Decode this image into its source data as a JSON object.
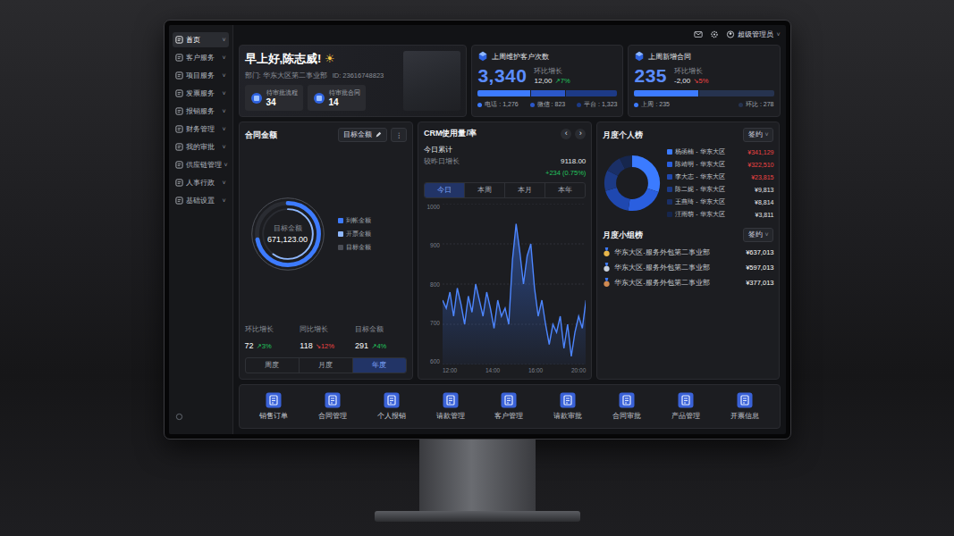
{
  "caret": "˅",
  "topbar": {
    "user": "超级管理员"
  },
  "sidebar": {
    "items": [
      {
        "label": "首页",
        "selected": true
      },
      {
        "label": "客户服务",
        "selected": false
      },
      {
        "label": "项目服务",
        "selected": false
      },
      {
        "label": "发票服务",
        "selected": false
      },
      {
        "label": "报销服务",
        "selected": false
      },
      {
        "label": "财务管理",
        "selected": false
      },
      {
        "label": "我的审批",
        "selected": false
      },
      {
        "label": "供应链管理",
        "selected": false
      },
      {
        "label": "人事行政",
        "selected": false
      },
      {
        "label": "基础设置",
        "selected": false
      }
    ]
  },
  "welcome": {
    "greeting": "早上好,陈志威!",
    "icon": "☀",
    "department": "部门: 华东大区第二事业部",
    "id": "ID: 23616748823",
    "stats": [
      {
        "label": "待审批流程",
        "value": "34"
      },
      {
        "label": "待审批合同",
        "value": "14"
      }
    ]
  },
  "kpis": [
    {
      "title": "上周维护客户次数",
      "value": "3,340",
      "compare_label": "环比增长",
      "compare_value": "12,00",
      "change": "↗7%",
      "trend": "up",
      "segments": [
        {
          "label": "电话 : 1,276",
          "level": 0.38,
          "color": "#3d7bff"
        },
        {
          "label": "微信 : 823",
          "level": 0.25,
          "color": "#2b57c9"
        },
        {
          "label": "平台 : 1,323",
          "level": 0.37,
          "color": "#1d3a86"
        }
      ]
    },
    {
      "title": "上周新增合同",
      "value": "235",
      "compare_label": "环比增长",
      "compare_value": "-2,00",
      "change": "↘5%",
      "trend": "down",
      "segments": [
        {
          "label": "上周 : 235",
          "level": 0.46,
          "color": "#3d7bff"
        },
        {
          "label": "环比 : 278",
          "level": 0.54,
          "color": "#26334f"
        }
      ]
    }
  ],
  "contract": {
    "title": "合同金额",
    "button": "目标金额",
    "menu": "⋮",
    "center_label": "目标金额",
    "center_value": "671,123.00",
    "rings": [
      {
        "label": "到帐金额",
        "level": 0.72,
        "color": "#3d7bff"
      },
      {
        "label": "开票金额",
        "level": 0.6,
        "color": "#8fb8ff"
      },
      {
        "label": "目标金额",
        "level": 1.0,
        "color": "#4a4d55"
      }
    ],
    "stats": [
      {
        "label": "环比增长",
        "value": "72",
        "change": "↗3%",
        "trend": "up"
      },
      {
        "label": "同比增长",
        "value": "118",
        "change": "↘12%",
        "trend": "down"
      },
      {
        "label": "目标金额",
        "value": "291",
        "change": "↗4%",
        "trend": "up"
      }
    ],
    "tabs": [
      {
        "label": "周度",
        "selected": false
      },
      {
        "label": "月度",
        "selected": false
      },
      {
        "label": "年度",
        "selected": true
      }
    ]
  },
  "crm": {
    "title": "CRM使用量/率",
    "prev": "‹",
    "next": "›",
    "total_label": "今日累计",
    "growth_label": "较昨日增长",
    "total_value": "9118.00",
    "growth_value": "+234 (0.75%)",
    "tabs": [
      {
        "label": "今日",
        "selected": true
      },
      {
        "label": "本周",
        "selected": false
      },
      {
        "label": "本月",
        "selected": false
      },
      {
        "label": "本年",
        "selected": false
      }
    ],
    "chart": {
      "y_ticks": [
        "1000",
        "900",
        "800",
        "700",
        "600"
      ],
      "x_ticks": [
        "12:00",
        "14:00",
        "16:00",
        "20:00"
      ],
      "values": [
        760,
        740,
        780,
        720,
        790,
        750,
        700,
        770,
        730,
        800,
        760,
        720,
        780,
        740,
        690,
        760,
        720,
        740,
        700,
        860,
        950,
        880,
        800,
        870,
        900,
        790,
        720,
        760,
        700,
        650,
        700,
        680,
        720,
        640,
        700,
        620,
        680,
        720,
        690,
        760
      ]
    }
  },
  "ranking": {
    "title": "月度个人榜",
    "filter": "签约",
    "people": [
      {
        "name": "杨函楠 - 华东大区",
        "amount": "¥341,129",
        "highlight": true,
        "level": 0.3,
        "color": "#3b7bff"
      },
      {
        "name": "陈靖明 - 华东大区",
        "amount": "¥322,510",
        "highlight": true,
        "level": 0.22,
        "color": "#2a5fe0"
      },
      {
        "name": "李大志 - 华东大区",
        "amount": "¥23,815",
        "highlight": true,
        "level": 0.18,
        "color": "#1f48b0"
      },
      {
        "name": "陈二妮 - 华东大区",
        "amount": "¥9,813",
        "highlight": false,
        "level": 0.12,
        "color": "#1c3a86"
      },
      {
        "name": "王燕琦 - 华东大区",
        "amount": "¥8,814",
        "highlight": false,
        "level": 0.1,
        "color": "#1a2f66"
      },
      {
        "name": "汪雨萌 - 华东大区",
        "amount": "¥3,811",
        "highlight": false,
        "level": 0.08,
        "color": "#16264d"
      }
    ]
  },
  "teams": {
    "title": "月度小组榜",
    "filter": "签约",
    "rows": [
      {
        "name": "华东大区-服务外包第二事业部",
        "amount": "¥637,013",
        "color": "#e8b64a"
      },
      {
        "name": "华东大区-服务外包第二事业部",
        "amount": "¥597,013",
        "color": "#c9d1dc"
      },
      {
        "name": "华东大区-服务外包第二事业部",
        "amount": "¥377,013",
        "color": "#d08a52"
      }
    ]
  },
  "shortcuts": [
    "销售订单",
    "合同管理",
    "个人报销",
    "请款管理",
    "客户管理",
    "请款审批",
    "合同审批",
    "产品管理",
    "开票信息"
  ]
}
